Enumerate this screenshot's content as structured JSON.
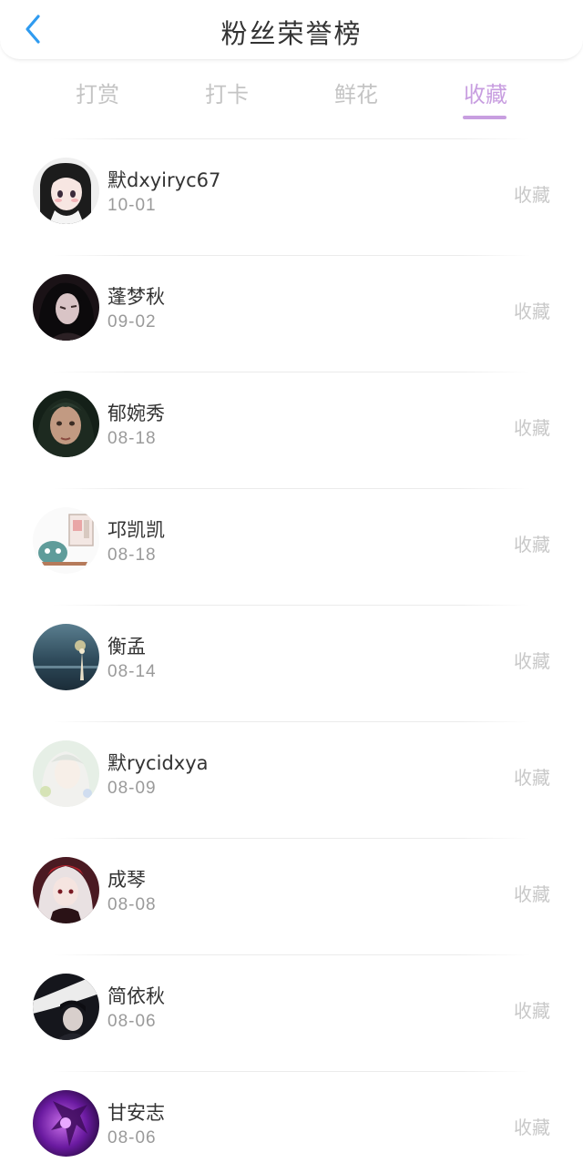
{
  "header": {
    "title": "粉丝荣誉榜",
    "back_icon": "chevron-left-icon",
    "accent": "#2f9bf0"
  },
  "tabs": [
    {
      "label": "打赏",
      "active": false
    },
    {
      "label": "打卡",
      "active": false
    },
    {
      "label": "鲜花",
      "active": false
    },
    {
      "label": "收藏",
      "active": true
    }
  ],
  "colors": {
    "active_tab": "#c89ee0",
    "inactive_tab": "#c4c4c4",
    "name": "#333333",
    "date": "#9a9a9a",
    "action": "#c8c8c8"
  },
  "fans": [
    {
      "name": "默dxyiryc67",
      "date": "10-01",
      "action": "收藏"
    },
    {
      "name": "蓬梦秋",
      "date": "09-02",
      "action": "收藏"
    },
    {
      "name": "郁婉秀",
      "date": "08-18",
      "action": "收藏"
    },
    {
      "name": "邛凯凯",
      "date": "08-18",
      "action": "收藏"
    },
    {
      "name": "衡孟",
      "date": "08-14",
      "action": "收藏"
    },
    {
      "name": "默rycidxya",
      "date": "08-09",
      "action": "收藏"
    },
    {
      "name": "成琴",
      "date": "08-08",
      "action": "收藏"
    },
    {
      "name": "简依秋",
      "date": "08-06",
      "action": "收藏"
    },
    {
      "name": "甘安志",
      "date": "08-06",
      "action": "收藏"
    }
  ]
}
